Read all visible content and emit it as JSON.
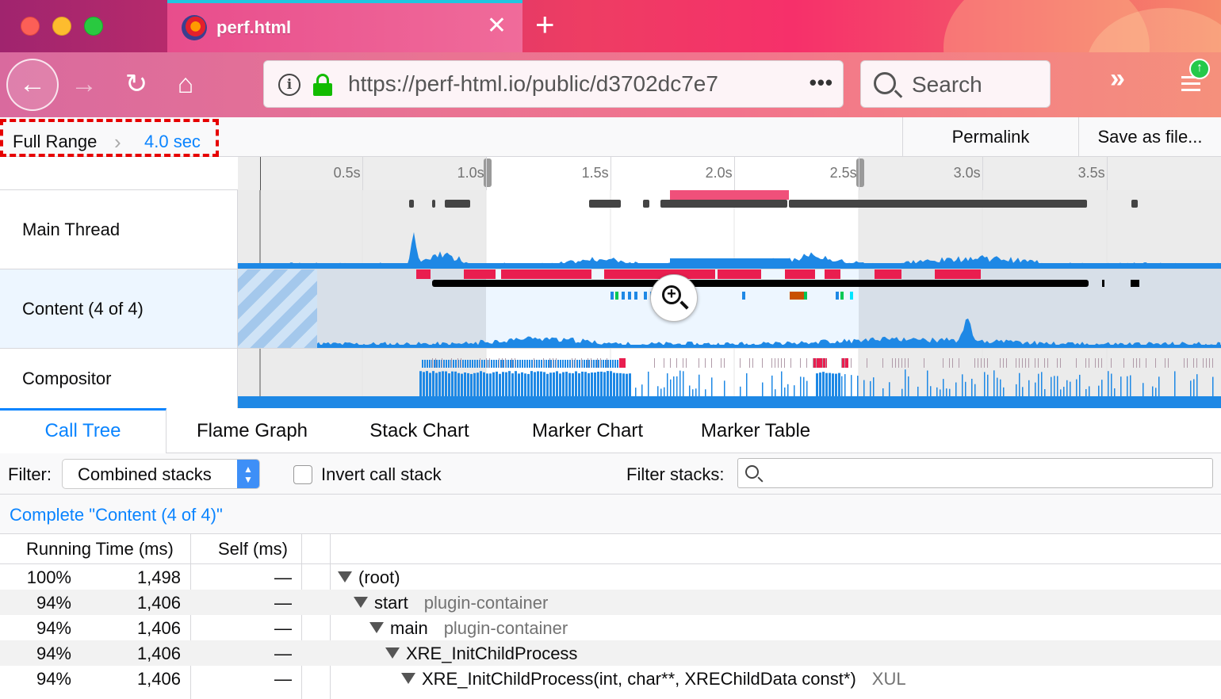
{
  "browser": {
    "tab_title": "perf.html",
    "url": "https://perf-html.io/public/d3702dc7e7",
    "search_placeholder": "Search"
  },
  "range": {
    "full_label": "Full Range",
    "selection_label": "4.0 sec",
    "permalink_label": "Permalink",
    "save_label": "Save as file..."
  },
  "timeline": {
    "ticks": [
      "0.5s",
      "1.0s",
      "1.5s",
      "2.0s",
      "2.5s",
      "3.0s",
      "3.5s"
    ],
    "tracks": [
      {
        "label": "Main Thread"
      },
      {
        "label": "Content (4 of 4)"
      },
      {
        "label": "Compositor"
      }
    ]
  },
  "details": {
    "tabs": [
      "Call Tree",
      "Flame Graph",
      "Stack Chart",
      "Marker Chart",
      "Marker Table"
    ],
    "active_tab": "Call Tree",
    "filter_label": "Filter:",
    "filter_value": "Combined stacks",
    "invert_label": "Invert call stack",
    "filter_stacks_label": "Filter stacks:",
    "breadcrumb": "Complete \"Content (4 of 4)\"",
    "columns": {
      "running": "Running Time (ms)",
      "self": "Self (ms)"
    },
    "rows": [
      {
        "pct": "100%",
        "ms": "1,498",
        "self": "—",
        "name": "(root)",
        "lib": ""
      },
      {
        "pct": "94%",
        "ms": "1,406",
        "self": "—",
        "name": "start",
        "lib": "plugin-container"
      },
      {
        "pct": "94%",
        "ms": "1,406",
        "self": "—",
        "name": "main",
        "lib": "plugin-container"
      },
      {
        "pct": "94%",
        "ms": "1,406",
        "self": "—",
        "name": "XRE_InitChildProcess",
        "lib": ""
      },
      {
        "pct": "94%",
        "ms": "1,406",
        "self": "—",
        "name": "XRE_InitChildProcess(int, char**, XREChildData const*)",
        "lib": "XUL"
      }
    ]
  },
  "colors": {
    "accent": "#0a84ff",
    "graph_blue": "#1e88e5",
    "marker_red": "#e91e4f",
    "highlight_border": "#e60000"
  }
}
